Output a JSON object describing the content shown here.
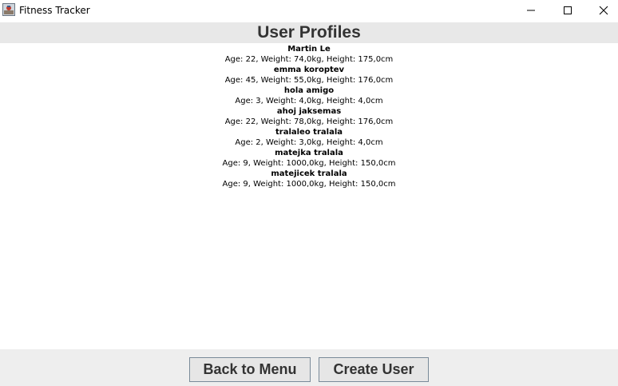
{
  "window": {
    "title": "Fitness Tracker",
    "icon": "java-app-icon"
  },
  "header": {
    "title": "User Profiles"
  },
  "profiles": [
    {
      "name": "Martin Le",
      "details": "Age: 22, Weight: 74,0kg, Height: 175,0cm"
    },
    {
      "name": "emma koroptev",
      "details": "Age: 45, Weight: 55,0kg, Height: 176,0cm"
    },
    {
      "name": "hola amigo",
      "details": "Age: 3, Weight: 4,0kg, Height: 4,0cm"
    },
    {
      "name": "ahoj jaksemas",
      "details": "Age: 22, Weight: 78,0kg, Height: 176,0cm"
    },
    {
      "name": "tralaleo tralala",
      "details": "Age: 2, Weight: 3,0kg, Height: 4,0cm"
    },
    {
      "name": "matejka tralala",
      "details": "Age: 9, Weight: 1000,0kg, Height: 150,0cm"
    },
    {
      "name": "matejicek tralala",
      "details": "Age: 9, Weight: 1000,0kg, Height: 150,0cm"
    }
  ],
  "footer": {
    "back_label": "Back to Menu",
    "create_label": "Create User"
  },
  "colors": {
    "header_bg": "#e8e8e8",
    "footer_bg": "#eeeeee",
    "button_border": "#7a8a99",
    "title_text": "#333333"
  }
}
